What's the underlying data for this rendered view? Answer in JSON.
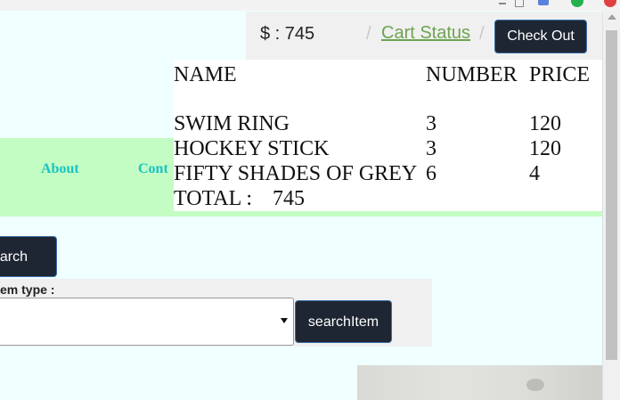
{
  "browser": {
    "icons": [
      "minimize-icon",
      "restore-icon",
      "extension-icon",
      "profile-icon",
      "close-icon"
    ]
  },
  "header": {
    "cart_total": "$ : 745",
    "separator": "/",
    "cart_status_link": "Cart Status",
    "checkout_label": "Check Out"
  },
  "nav": {
    "about_label": "About",
    "contact_label": "Cont"
  },
  "cart_table": {
    "columns": [
      "NAME",
      "NUMBER",
      "PRICE"
    ],
    "rows": [
      {
        "name": "SWIM RING",
        "number": "3",
        "price": "120"
      },
      {
        "name": "HOCKEY STICK",
        "number": "3",
        "price": "120"
      },
      {
        "name": "FIFTY SHADES OF GREY",
        "number": "6",
        "price": "4"
      }
    ],
    "total_label": "TOTAL :",
    "total_value": "745"
  },
  "search": {
    "button_label": "earch",
    "item_type_label": "em type :",
    "select_value": "",
    "searchitem_label": "searchItem"
  },
  "colors": {
    "page_bg": "#f0ffff",
    "nav_bg": "#c3fdc3",
    "nav_link": "#19c3c3",
    "button_bg": "#1f2633",
    "link": "#6ea351"
  }
}
